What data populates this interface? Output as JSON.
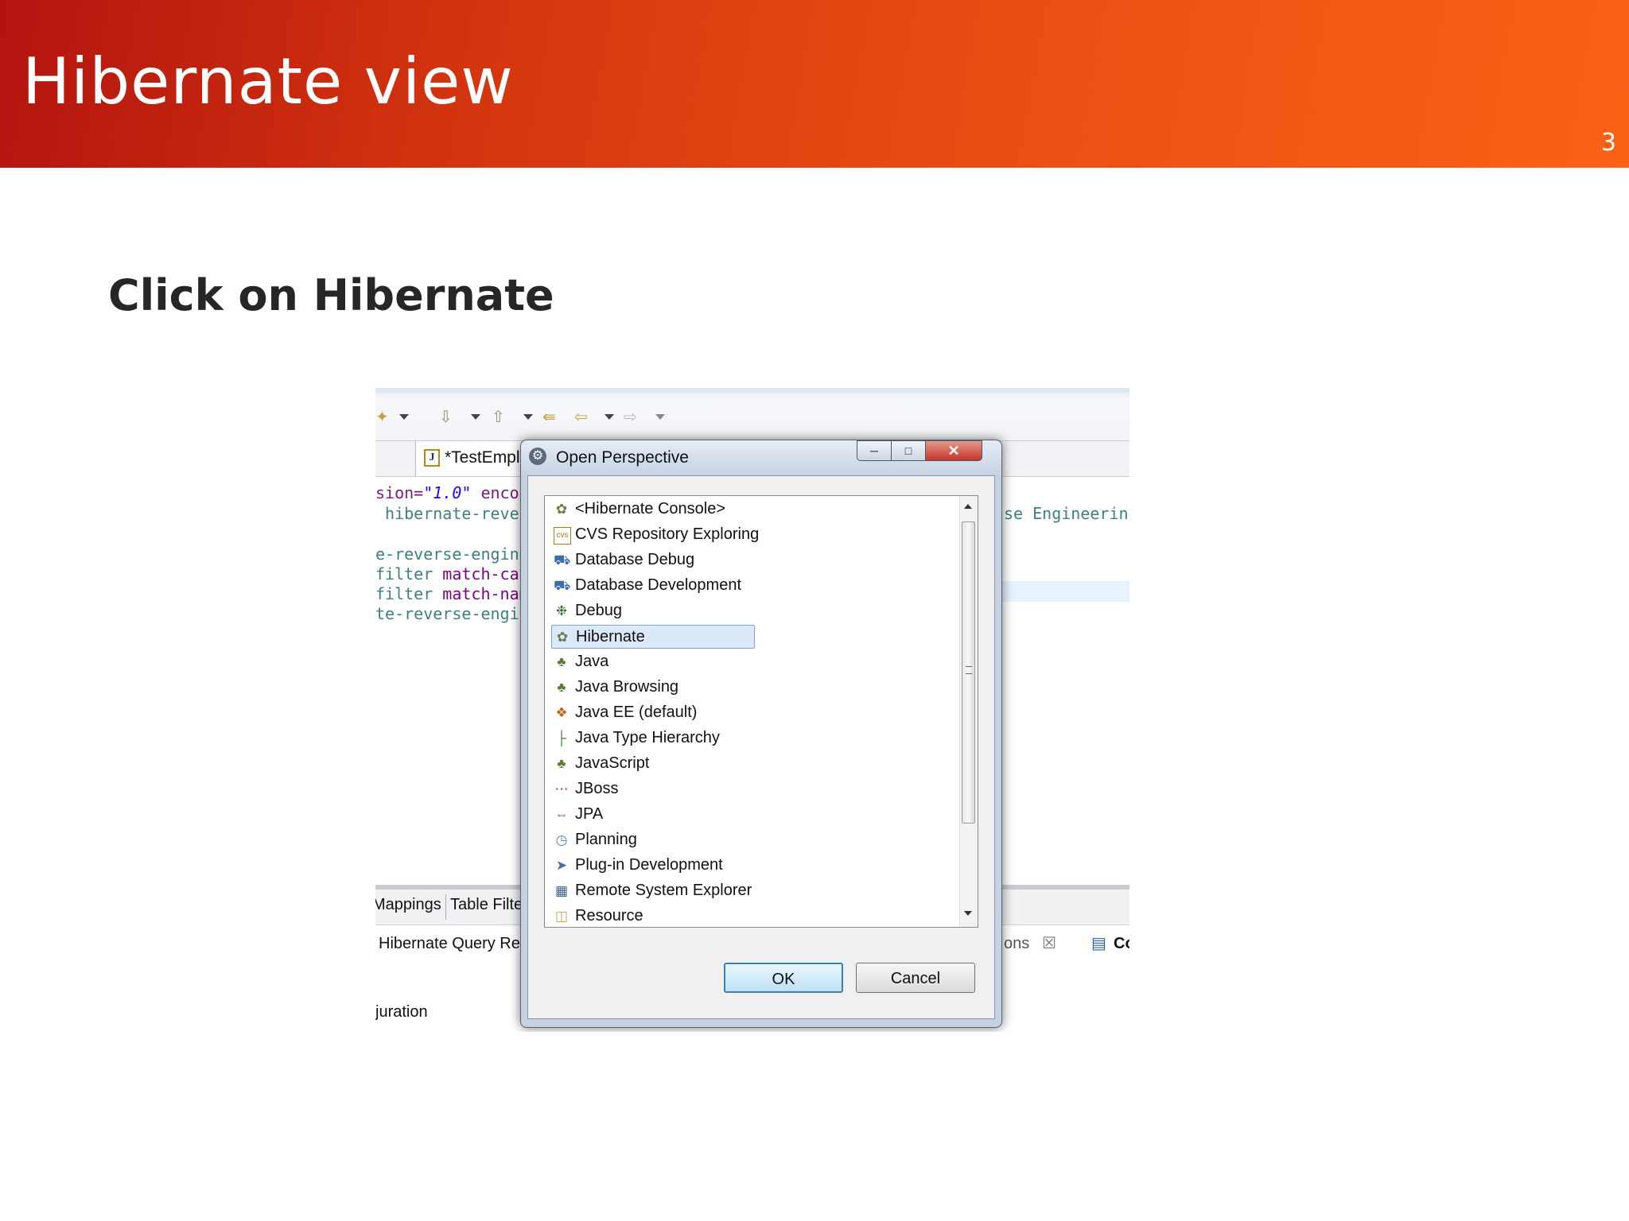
{
  "slide": {
    "title": "Hibernate view",
    "number": "3",
    "subtitle": "Click  on Hibernate"
  },
  "colors": {
    "banner_start": "#b3140f",
    "banner_end": "#fb6216",
    "selection": "#dce9fb"
  },
  "editor": {
    "tab_label": "*TestEmpl",
    "code_lines": [
      {
        "a": "sion=",
        "b": "\"1.0\"",
        "c": " encod"
      },
      {
        "a": " hibernate-rever",
        "b": "",
        "c": ""
      },
      {
        "a": "",
        "b": "",
        "c": ""
      },
      {
        "a": "e-reverse-engine",
        "b": "",
        "c": ""
      },
      {
        "a": "filter",
        "b": " match-cat",
        "c": ""
      },
      {
        "a": "filter",
        "b": " match-nam",
        "c": ""
      },
      {
        "a": "te-reverse-engin",
        "b": "",
        "c": ""
      }
    ],
    "right_text": "se Engineerin",
    "bottom_tabs": [
      "Mappings",
      "Table Filte"
    ],
    "bottom_tab2": "Hibernate Query Res",
    "right_tab_text": "ons",
    "right_tab_text2": "Co",
    "bottom_line": "juration"
  },
  "dialog": {
    "title": "Open Perspective",
    "items": [
      {
        "label": "<Hibernate Console>",
        "icon": "hibernate-icon",
        "selected": false
      },
      {
        "label": "CVS Repository Exploring",
        "icon": "cvs-icon",
        "selected": false
      },
      {
        "label": "Database Debug",
        "icon": "database-debug-icon",
        "selected": false
      },
      {
        "label": "Database Development",
        "icon": "database-icon",
        "selected": false
      },
      {
        "label": "Debug",
        "icon": "bug-icon",
        "selected": false
      },
      {
        "label": "Hibernate",
        "icon": "hibernate-icon",
        "selected": true
      },
      {
        "label": "Java",
        "icon": "java-icon",
        "selected": false
      },
      {
        "label": "Java Browsing",
        "icon": "java-browsing-icon",
        "selected": false
      },
      {
        "label": "Java EE (default)",
        "icon": "java-ee-icon",
        "selected": false
      },
      {
        "label": "Java Type Hierarchy",
        "icon": "hierarchy-icon",
        "selected": false
      },
      {
        "label": "JavaScript",
        "icon": "javascript-icon",
        "selected": false
      },
      {
        "label": "JBoss",
        "icon": "jboss-icon",
        "selected": false
      },
      {
        "label": "JPA",
        "icon": "jpa-icon",
        "selected": false
      },
      {
        "label": "Planning",
        "icon": "clock-icon",
        "selected": false
      },
      {
        "label": "Plug-in Development",
        "icon": "plugin-icon",
        "selected": false
      },
      {
        "label": "Remote System Explorer",
        "icon": "remote-system-icon",
        "selected": false
      },
      {
        "label": "Resource",
        "icon": "folder-icon",
        "selected": false
      }
    ],
    "ok_label": "OK",
    "cancel_label": "Cancel"
  }
}
